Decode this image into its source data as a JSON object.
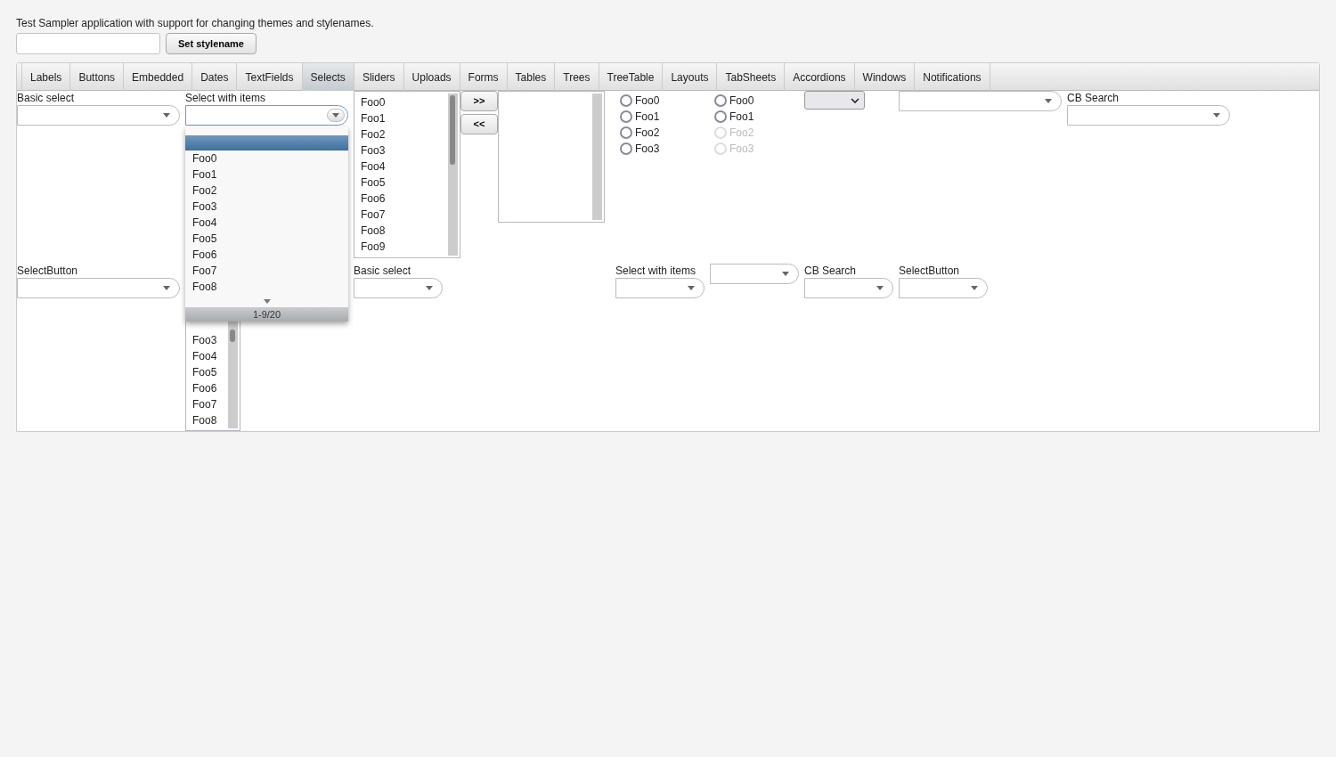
{
  "description": "Test Sampler application with support for changing themes and stylenames.",
  "stylename_button": "Set stylename",
  "tabs": [
    {
      "label": "Labels",
      "selected": false
    },
    {
      "label": "Buttons",
      "selected": false
    },
    {
      "label": "Embedded",
      "selected": false
    },
    {
      "label": "Dates",
      "selected": false
    },
    {
      "label": "TextFields",
      "selected": false
    },
    {
      "label": "Selects",
      "selected": true
    },
    {
      "label": "Sliders",
      "selected": false
    },
    {
      "label": "Uploads",
      "selected": false
    },
    {
      "label": "Forms",
      "selected": false
    },
    {
      "label": "Tables",
      "selected": false
    },
    {
      "label": "Trees",
      "selected": false
    },
    {
      "label": "TreeTable",
      "selected": false
    },
    {
      "label": "Layouts",
      "selected": false
    },
    {
      "label": "TabSheets",
      "selected": false
    },
    {
      "label": "Accordions",
      "selected": false
    },
    {
      "label": "Windows",
      "selected": false
    },
    {
      "label": "Notifications",
      "selected": false
    }
  ],
  "rows": [
    [
      {
        "kind": "combo",
        "label": "Basic select",
        "focused": false
      },
      {
        "kind": "combo",
        "label": "Select with items",
        "focused": true,
        "popup": {
          "blank_selected": true,
          "items": [
            {
              "label": "Foo0",
              "selected": false
            },
            {
              "label": "Foo1",
              "selected": false
            },
            {
              "label": "Foo2",
              "selected": false
            },
            {
              "label": "Foo3",
              "selected": false
            },
            {
              "label": "Foo4",
              "selected": false
            },
            {
              "label": "Foo5",
              "selected": false
            },
            {
              "label": "Foo6",
              "selected": false
            },
            {
              "label": "Foo7",
              "selected": false
            },
            {
              "label": "Foo8",
              "selected": false
            }
          ],
          "page": "1-9/20"
        }
      },
      {
        "kind": "listbox",
        "items": [
          {
            "label": "Foo0",
            "selected": false
          },
          {
            "label": "Foo1",
            "selected": false
          },
          {
            "label": "Foo2",
            "selected": false
          },
          {
            "label": "Foo3",
            "selected": false
          },
          {
            "label": "Foo4",
            "selected": false
          },
          {
            "label": "Foo5",
            "selected": false
          },
          {
            "label": "Foo6",
            "selected": false
          },
          {
            "label": "Foo7",
            "selected": false
          },
          {
            "label": "Foo8",
            "selected": false
          },
          {
            "label": "Foo9",
            "selected": false
          }
        ]
      },
      {
        "kind": "buttons",
        "buttons": [
          ">>",
          "<<"
        ]
      },
      {
        "kind": "listbox"
      },
      {
        "kind": "radios",
        "options": [
          {
            "label": "Foo0",
            "selected": false,
            "disabled": false
          },
          {
            "label": "Foo1",
            "selected": false,
            "disabled": false
          },
          {
            "label": "Foo2",
            "selected": false,
            "disabled": false
          },
          {
            "label": "Foo3",
            "selected": false,
            "disabled": false
          }
        ]
      },
      {
        "kind": "radios",
        "options": [
          {
            "label": "Foo0",
            "selected": false,
            "disabled": false
          },
          {
            "label": "Foo1",
            "selected": false,
            "disabled": false
          },
          {
            "label": "Foo2",
            "selected": false,
            "disabled": true
          },
          {
            "label": "Foo3",
            "selected": false,
            "disabled": true
          }
        ]
      },
      {
        "kind": "native"
      },
      {
        "kind": "combo",
        "focused": false
      },
      {
        "kind": "combo",
        "label": "CB Search",
        "focused": false
      }
    ],
    [
      {
        "kind": "combo",
        "label": "SelectButton",
        "focused": false
      },
      {
        "kind": "listbox",
        "items": [
          {
            "label": "Foo3",
            "selected": false
          },
          {
            "label": "Foo4",
            "selected": false
          },
          {
            "label": "Foo5",
            "selected": false
          },
          {
            "label": "Foo6",
            "selected": false
          },
          {
            "label": "Foo7",
            "selected": false
          },
          {
            "label": "Foo8",
            "selected": false
          }
        ]
      },
      {
        "kind": "combo",
        "label": "Basic select",
        "focused": false
      },
      {
        "kind": "combo",
        "label": "Select with items",
        "focused": false
      },
      {
        "kind": "combo",
        "focused": false
      },
      {
        "kind": "combo",
        "label": "CB Search",
        "focused": false
      },
      {
        "kind": "combo",
        "label": "SelectButton",
        "focused": false
      }
    ]
  ]
}
